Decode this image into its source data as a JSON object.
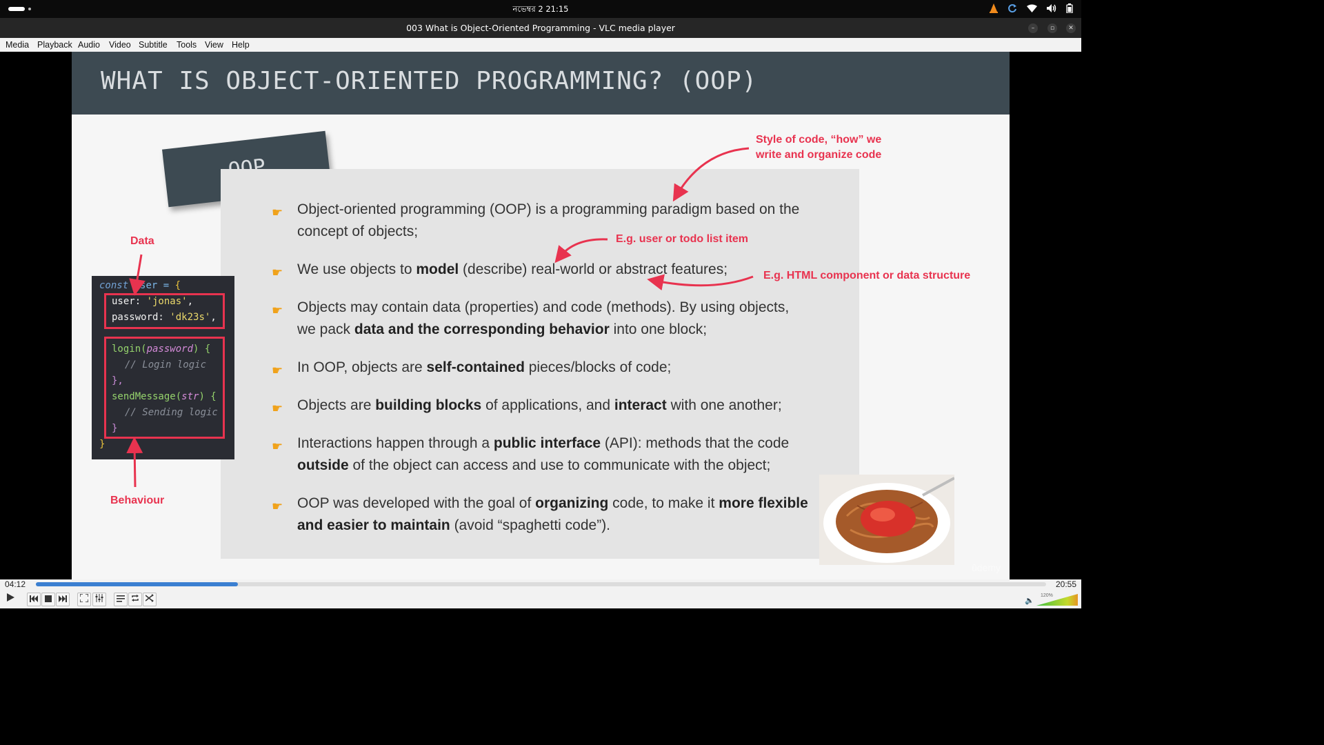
{
  "topbar": {
    "clock": "নভেম্বর 2  21:15",
    "tray_icons": [
      "vlc-icon",
      "refresh-icon",
      "wifi-icon",
      "volume-icon",
      "battery-icon"
    ]
  },
  "window": {
    "title": "003 What is Object-Oriented Programming - VLC media player",
    "controls": [
      "minimize",
      "restore",
      "close"
    ]
  },
  "menu": [
    "Media",
    "Playback",
    "Audio",
    "Video",
    "Subtitle",
    "Tools",
    "View",
    "Help"
  ],
  "slide": {
    "title": "WHAT IS OBJECT-ORIENTED PROGRAMMING? (OOP)",
    "oop_label": "OOP",
    "annotations": {
      "style": [
        "Style of code, “how” we",
        "write and organize code"
      ],
      "example_item": "E.g. user or todo list item",
      "example_html": "E.g. HTML component or data structure",
      "data": "Data",
      "behaviour": "Behaviour"
    },
    "code": {
      "l1_const": "const",
      "l1_user": " user = ",
      "l1_brace": "{",
      "l2_key": "user: ",
      "l2_val": "'jonas'",
      "l2_end": ",",
      "l3_key": "password: ",
      "l3_val": "'dk23s'",
      "l3_end": ",",
      "l4_fn": "login(",
      "l4_param": "password",
      "l4_end": ") {",
      "l5": "// Login logic",
      "l6": "},",
      "l7_fn": "sendMessage(",
      "l7_param": "str",
      "l7_end": ") {",
      "l8": "// Sending logic",
      "l9": "}",
      "l10": "}"
    },
    "bullets": {
      "b1": "Object-oriented programming (OOP) is a programming paradigm based on the concept of objects;",
      "b2": {
        "t1": "We use objects to ",
        "b1": "model",
        "t2": " (describe) real-world or abstract features;"
      },
      "b3": {
        "t1": "Objects may contain data (properties) and code (methods). By using objects, we pack ",
        "b1": "data and the corresponding behavior",
        "t2": " into one block;"
      },
      "b4": {
        "t1": "In OOP, objects are ",
        "b1": "self-contained",
        "t2": " pieces/blocks of code;"
      },
      "b5": {
        "t1": "Objects are ",
        "b1": "building blocks",
        "t2": " of applications, and ",
        "b2": "interact",
        "t3": " with one another;"
      },
      "b6": {
        "t1": "Interactions happen through a ",
        "b1": "public interface",
        "t2": " (API): methods that the code ",
        "b2": "outside",
        "t3": " of the object can access and use to communicate with the object;"
      },
      "b7": {
        "t1": "OOP was developed with the goal of ",
        "b1": "organizing",
        "t2": " code, to make it ",
        "b2": "more flexible and easier to maintain",
        "t3": " (avoid “spaghetti code”)."
      }
    },
    "watermark": "ûdemy",
    "colors": {
      "accent": "#e8334f",
      "header": "#3d4a52",
      "bullet": "#f0a21b"
    }
  },
  "player": {
    "current_time": "04:12",
    "total_time": "20:55",
    "progress": 0.2,
    "volume_label": "120%",
    "volume_level": 1.2,
    "buttons": [
      "play",
      "previous",
      "stop",
      "next",
      "fullscreen",
      "extended-settings",
      "playlist",
      "loop",
      "shuffle"
    ]
  }
}
